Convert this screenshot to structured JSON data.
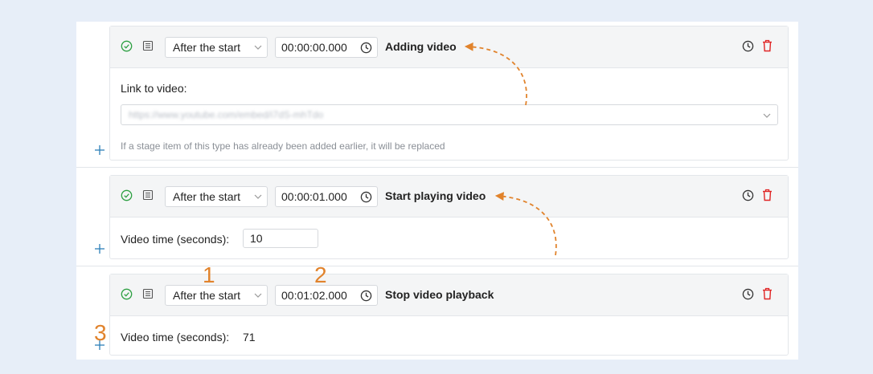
{
  "stages": [
    {
      "select_value": "After the start",
      "time_value": "00:00:00.000",
      "title": "Adding video",
      "field_label": "Link to video:",
      "url_value": "https://www.youtube.com/embed/i7dS-mhTdo",
      "hint": "If a stage item of this type has already been added earlier, it will be replaced"
    },
    {
      "select_value": "After the start",
      "time_value": "00:00:01.000",
      "title": "Start playing video",
      "field_label": "Video time (seconds):",
      "field_value": "10"
    },
    {
      "select_value": "After the start",
      "time_value": "00:01:02.000",
      "title": "Stop video playback",
      "field_label": "Video time (seconds):",
      "field_value": "71"
    }
  ],
  "annotations": {
    "one": "1",
    "two": "2",
    "three": "3"
  },
  "colors": {
    "accent_orange": "#e1832c",
    "ok_green": "#2ea043",
    "trash_red": "#e02424",
    "plus_blue": "#2d7fb8"
  },
  "icons": [
    "check-circle-icon",
    "list-icon",
    "chevron-down-icon",
    "clock-icon",
    "trash-icon",
    "plus-icon"
  ]
}
